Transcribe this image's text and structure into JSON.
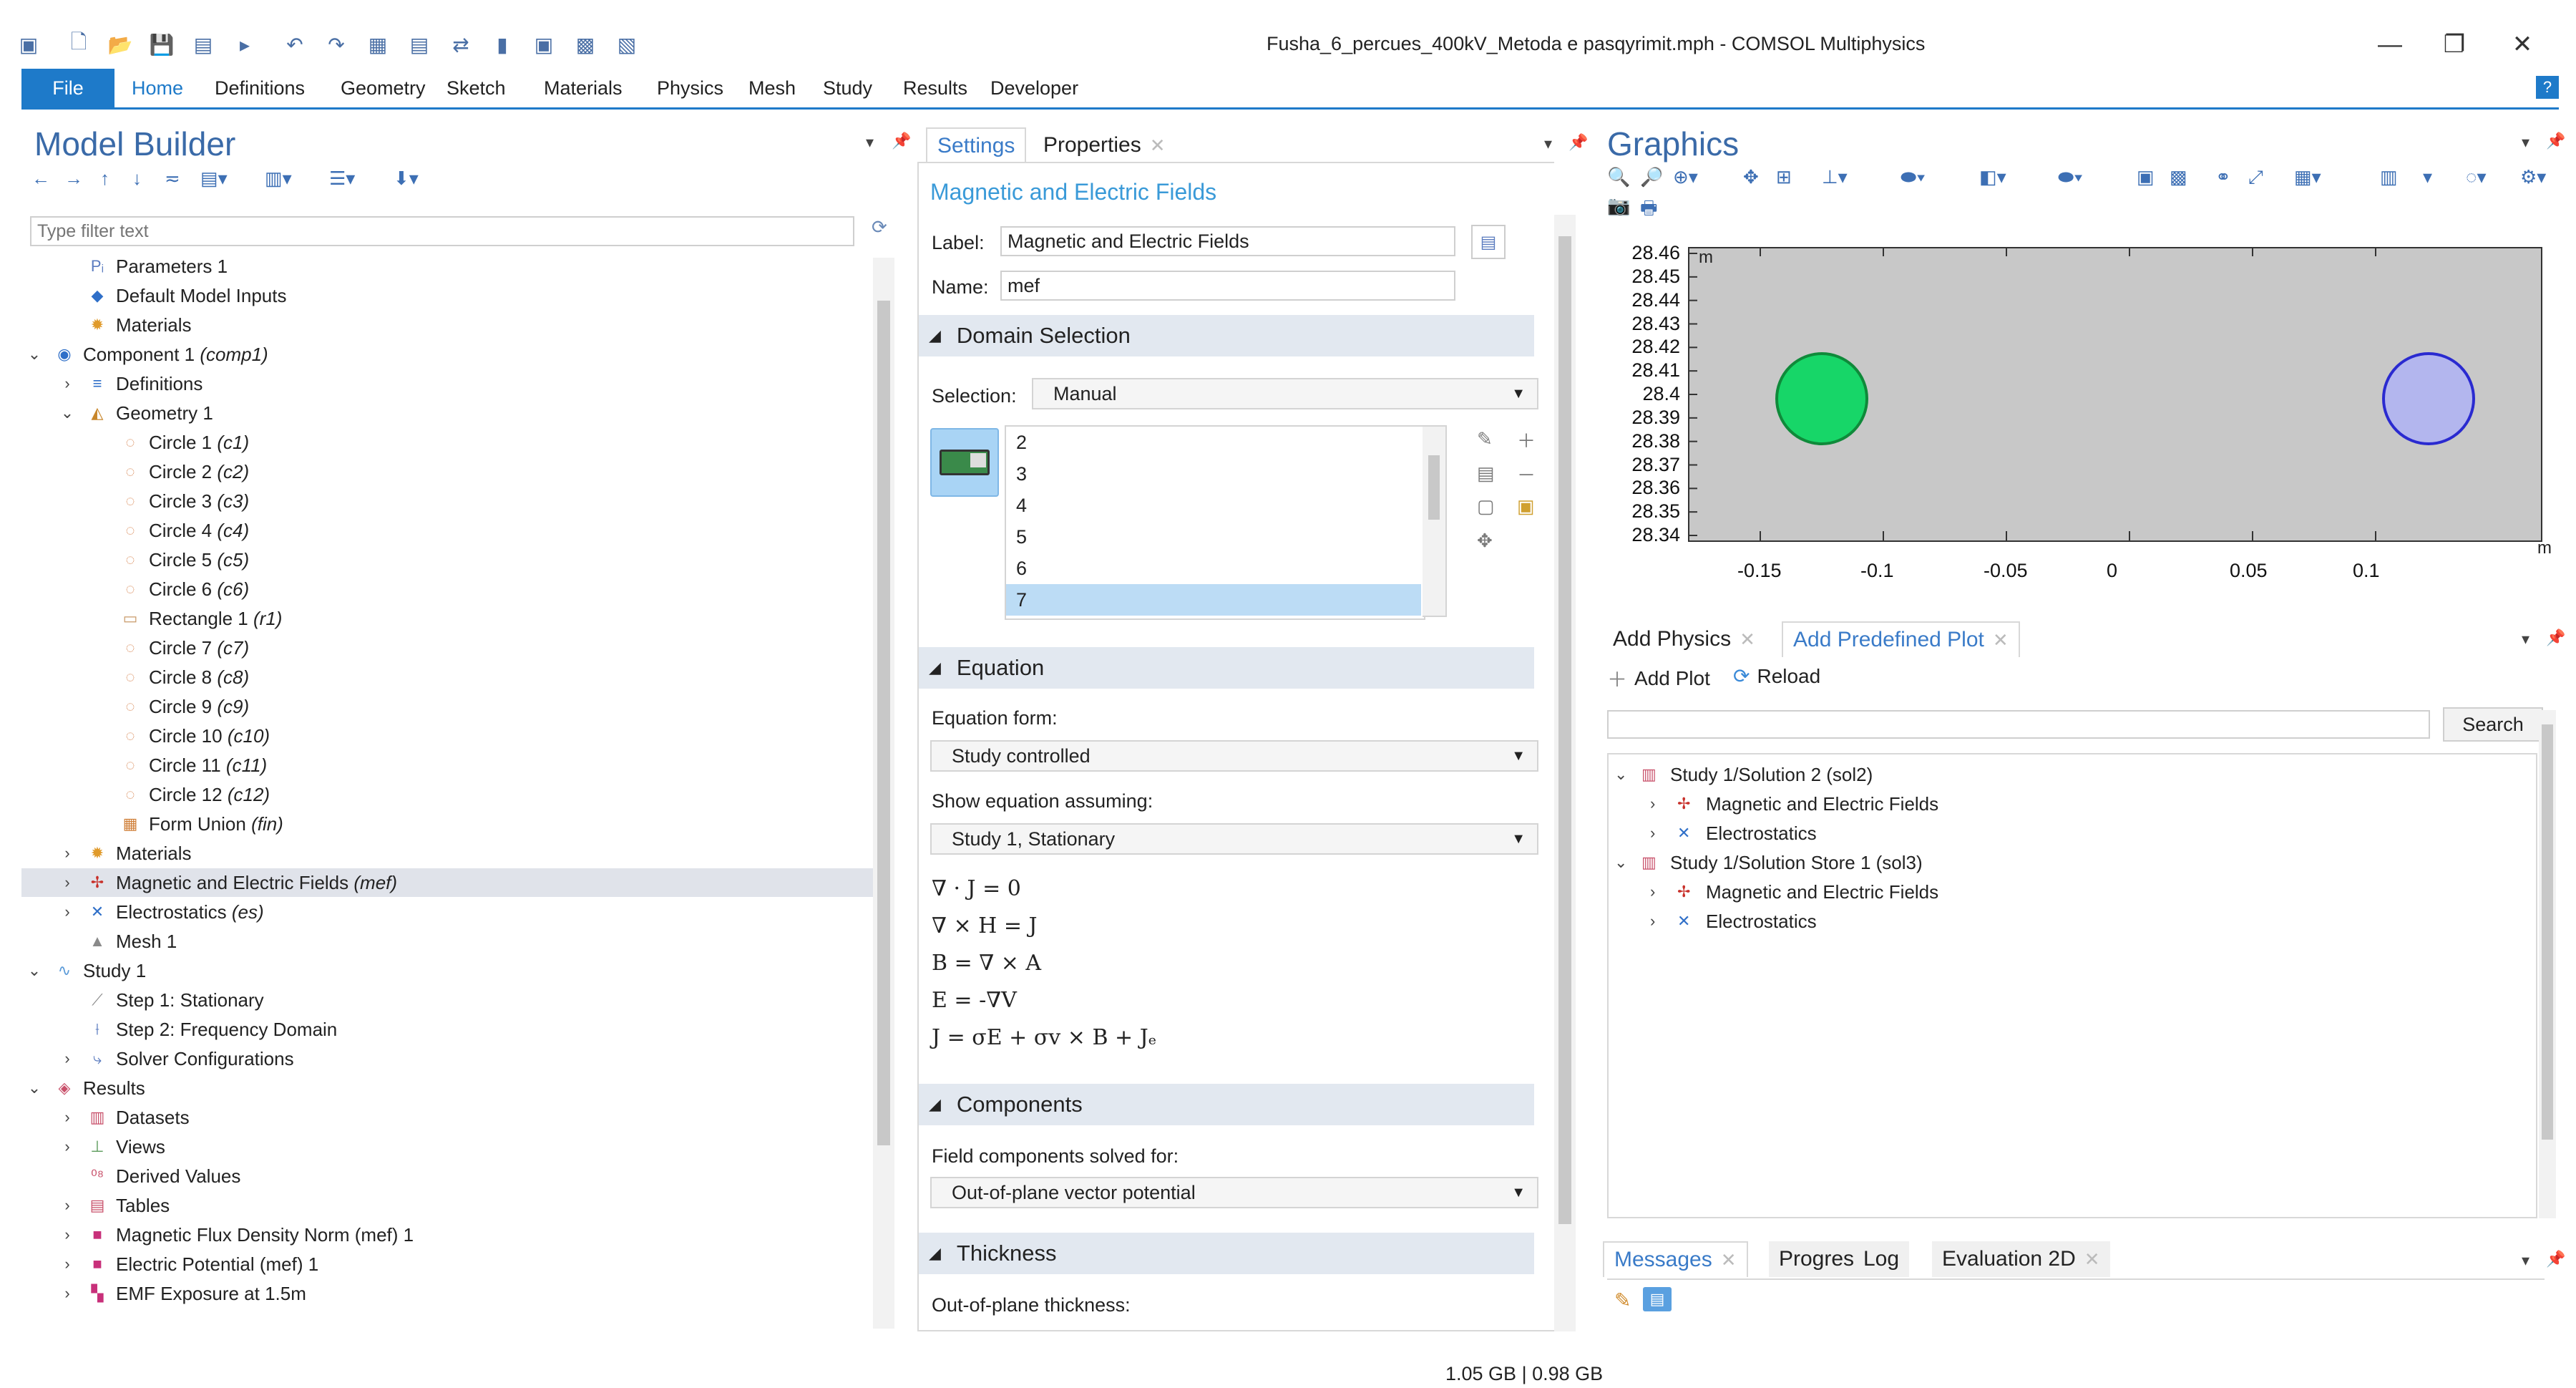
{
  "window": {
    "title": "Fusha_6_percues_400kV_Metoda e pasqyrimit.mph - COMSOL Multiphysics",
    "minimize": "—",
    "restore": "❐",
    "close": "✕"
  },
  "quick_access": [
    "▣",
    "🗋",
    "📂",
    "💾",
    "▤",
    "▸",
    "↶",
    "↷",
    "▦",
    "▤",
    "⇄",
    "▮",
    "▣",
    "▩",
    "▧"
  ],
  "ribbon": {
    "file": "File",
    "tabs": [
      "Home",
      "Definitions",
      "Geometry",
      "Sketch",
      "Materials",
      "Physics",
      "Mesh",
      "Study",
      "Results",
      "Developer"
    ],
    "active": "Home",
    "help": "?"
  },
  "model_builder": {
    "title": "Model Builder",
    "filter_placeholder": "Type filter text",
    "tree": [
      {
        "label": "Parameters 1",
        "tag": "",
        "level": 2,
        "chevron": "",
        "icon": "Pᵢ",
        "icon_color": "#5a7bbf"
      },
      {
        "label": "Default Model Inputs",
        "tag": "",
        "level": 2,
        "chevron": "",
        "icon": "◆",
        "icon_color": "#2f6fc8"
      },
      {
        "label": "Materials",
        "tag": "",
        "level": 2,
        "chevron": "",
        "icon": "✹",
        "icon_color": "#e09a2a"
      },
      {
        "label": "Component 1",
        "tag": "(comp1)",
        "level": 1,
        "chevron": "⌄",
        "icon": "◉",
        "icon_color": "#2f6fc8"
      },
      {
        "label": "Definitions",
        "tag": "",
        "level": 2,
        "chevron": "›",
        "icon": "≡",
        "icon_color": "#2f6fc8"
      },
      {
        "label": "Geometry 1",
        "tag": "",
        "level": 2,
        "chevron": "⌄",
        "icon": "◭",
        "icon_color": "#c8862a"
      },
      {
        "label": "Circle 1",
        "tag": "(c1)",
        "level": 3,
        "chevron": "",
        "icon": "◌",
        "icon_color": "#d98b5a"
      },
      {
        "label": "Circle 2",
        "tag": "(c2)",
        "level": 3,
        "chevron": "",
        "icon": "◌",
        "icon_color": "#d98b5a"
      },
      {
        "label": "Circle 3",
        "tag": "(c3)",
        "level": 3,
        "chevron": "",
        "icon": "◌",
        "icon_color": "#d98b5a"
      },
      {
        "label": "Circle 4",
        "tag": "(c4)",
        "level": 3,
        "chevron": "",
        "icon": "◌",
        "icon_color": "#d98b5a"
      },
      {
        "label": "Circle 5",
        "tag": "(c5)",
        "level": 3,
        "chevron": "",
        "icon": "◌",
        "icon_color": "#d98b5a"
      },
      {
        "label": "Circle 6",
        "tag": "(c6)",
        "level": 3,
        "chevron": "",
        "icon": "◌",
        "icon_color": "#d98b5a"
      },
      {
        "label": "Rectangle 1",
        "tag": "(r1)",
        "level": 3,
        "chevron": "",
        "icon": "▭",
        "icon_color": "#c99a6a"
      },
      {
        "label": "Circle 7",
        "tag": "(c7)",
        "level": 3,
        "chevron": "",
        "icon": "◌",
        "icon_color": "#d98b5a"
      },
      {
        "label": "Circle 8",
        "tag": "(c8)",
        "level": 3,
        "chevron": "",
        "icon": "◌",
        "icon_color": "#d98b5a"
      },
      {
        "label": "Circle 9",
        "tag": "(c9)",
        "level": 3,
        "chevron": "",
        "icon": "◌",
        "icon_color": "#d98b5a"
      },
      {
        "label": "Circle 10",
        "tag": "(c10)",
        "level": 3,
        "chevron": "",
        "icon": "◌",
        "icon_color": "#d98b5a"
      },
      {
        "label": "Circle 11",
        "tag": "(c11)",
        "level": 3,
        "chevron": "",
        "icon": "◌",
        "icon_color": "#d98b5a"
      },
      {
        "label": "Circle 12",
        "tag": "(c12)",
        "level": 3,
        "chevron": "",
        "icon": "◌",
        "icon_color": "#d98b5a"
      },
      {
        "label": "Form Union",
        "tag": "(fin)",
        "level": 3,
        "chevron": "",
        "icon": "▦",
        "icon_color": "#d0803a"
      },
      {
        "label": "Materials",
        "tag": "",
        "level": 2,
        "chevron": "›",
        "icon": "✹",
        "icon_color": "#e09a2a"
      },
      {
        "label": "Magnetic and Electric Fields",
        "tag": "(mef)",
        "level": 2,
        "chevron": "›",
        "icon": "✢",
        "icon_color": "#c8302a",
        "selected": true
      },
      {
        "label": "Electrostatics",
        "tag": "(es)",
        "level": 2,
        "chevron": "›",
        "icon": "✕",
        "icon_color": "#2f6fc8"
      },
      {
        "label": "Mesh 1",
        "tag": "",
        "level": 2,
        "chevron": "",
        "icon": "▲",
        "icon_color": "#8a8a8a"
      },
      {
        "label": "Study 1",
        "tag": "",
        "level": 1,
        "chevron": "⌄",
        "icon": "∿",
        "icon_color": "#5a9ad8"
      },
      {
        "label": "Step 1: Stationary",
        "tag": "",
        "level": 2,
        "chevron": "",
        "icon": "⟋",
        "icon_color": "#8a8a8a"
      },
      {
        "label": "Step 2: Frequency Domain",
        "tag": "",
        "level": 2,
        "chevron": "",
        "icon": "⟊",
        "icon_color": "#5a7bbf"
      },
      {
        "label": "Solver Configurations",
        "tag": "",
        "level": 2,
        "chevron": "›",
        "icon": "⤷",
        "icon_color": "#5a7bbf"
      },
      {
        "label": "Results",
        "tag": "",
        "level": 1,
        "chevron": "⌄",
        "icon": "◈",
        "icon_color": "#c8506a"
      },
      {
        "label": "Datasets",
        "tag": "",
        "level": 2,
        "chevron": "›",
        "icon": "▥",
        "icon_color": "#c8506a"
      },
      {
        "label": "Views",
        "tag": "",
        "level": 2,
        "chevron": "›",
        "icon": "⊥",
        "icon_color": "#5a9a5a"
      },
      {
        "label": "Derived Values",
        "tag": "",
        "level": 2,
        "chevron": "",
        "icon": "⁰⁸",
        "icon_color": "#c8506a"
      },
      {
        "label": "Tables",
        "tag": "",
        "level": 2,
        "chevron": "›",
        "icon": "▤",
        "icon_color": "#c8506a"
      },
      {
        "label": "Magnetic Flux Density Norm (mef) 1",
        "tag": "",
        "level": 2,
        "chevron": "›",
        "icon": "■",
        "icon_color": "#c8307a"
      },
      {
        "label": "Electric Potential (mef) 1",
        "tag": "",
        "level": 2,
        "chevron": "›",
        "icon": "■",
        "icon_color": "#c8307a"
      },
      {
        "label": "EMF Exposure at 1.5m",
        "tag": "",
        "level": 2,
        "chevron": "›",
        "icon": "▚",
        "icon_color": "#c8307a"
      }
    ]
  },
  "settings": {
    "tabs": [
      {
        "label": "Settings",
        "active": true
      },
      {
        "label": "Properties",
        "active": false
      }
    ],
    "title": "Magnetic and Electric Fields",
    "label_caption": "Label:",
    "label_value": "Magnetic and Electric Fields",
    "name_caption": "Name:",
    "name_value": "mef",
    "domain_selection": {
      "header": "Domain Selection",
      "selection_caption": "Selection:",
      "selection_value": "Manual",
      "items": [
        "2",
        "3",
        "4",
        "5",
        "6",
        "7"
      ],
      "selected_item": "7"
    },
    "equation": {
      "header": "Equation",
      "form_caption": "Equation form:",
      "form_value": "Study controlled",
      "assuming_caption": "Show equation assuming:",
      "assuming_value": "Study 1, Stationary",
      "equations": [
        "∇ · J = 0",
        "∇ × H = J",
        "B = ∇ × A",
        "E = -∇V",
        "J = σE + σv × B + Jₑ"
      ]
    },
    "components": {
      "header": "Components",
      "solved_caption": "Field components solved for:",
      "solved_value": "Out-of-plane vector potential"
    },
    "thickness": {
      "header": "Thickness",
      "caption": "Out-of-plane thickness:"
    }
  },
  "graphics": {
    "title": "Graphics",
    "unit_top": "m",
    "unit_right": "m",
    "y_ticks": [
      "28.46",
      "28.45",
      "28.44",
      "28.43",
      "28.42",
      "28.41",
      "28.4",
      "28.39",
      "28.38",
      "28.37",
      "28.36",
      "28.35",
      "28.34"
    ],
    "x_ticks": [
      "-0.15",
      "-0.1",
      "-0.05",
      "0",
      "0.05",
      "0.1"
    ],
    "background": "#c8c8c8",
    "circles": [
      {
        "name": "green-conductor",
        "fill": "#17d668",
        "stroke": "#0f8a3a"
      },
      {
        "name": "blue-conductor",
        "fill": "#b3b6ee",
        "stroke": "#2a2ad0"
      }
    ]
  },
  "plots": {
    "tabs": [
      {
        "label": "Add Physics",
        "active": false
      },
      {
        "label": "Add Predefined Plot",
        "active": true
      }
    ],
    "add_plot": "Add Plot",
    "reload": "Reload",
    "search_button": "Search",
    "tree": [
      {
        "label": "Study 1/Solution 2 (sol2)",
        "level": 1,
        "chevron": "⌄",
        "icon": "▥",
        "icon_color": "#c8506a"
      },
      {
        "label": "Magnetic and Electric Fields",
        "level": 2,
        "chevron": "›",
        "icon": "✢",
        "icon_color": "#c8302a"
      },
      {
        "label": "Electrostatics",
        "level": 2,
        "chevron": "›",
        "icon": "✕",
        "icon_color": "#2f6fc8"
      },
      {
        "label": "Study 1/Solution Store 1 (sol3)",
        "level": 1,
        "chevron": "⌄",
        "icon": "▥",
        "icon_color": "#c8506a"
      },
      {
        "label": "Magnetic and Electric Fields",
        "level": 2,
        "chevron": "›",
        "icon": "✢",
        "icon_color": "#c8302a"
      },
      {
        "label": "Electrostatics",
        "level": 2,
        "chevron": "›",
        "icon": "✕",
        "icon_color": "#2f6fc8"
      }
    ]
  },
  "messages": {
    "tabs": [
      {
        "label": "Messages",
        "active": true
      },
      {
        "label": "Progress",
        "active": false
      },
      {
        "label": "Log",
        "active": false
      },
      {
        "label": "Evaluation 2D",
        "active": false
      }
    ]
  },
  "status": {
    "memory": "1.05 GB | 0.98 GB"
  },
  "colors": {
    "accent": "#1e7ac9",
    "title_blue": "#3a6aa8",
    "selected_row": "#e0e3ea",
    "section_bg": "#e2e8f0"
  }
}
